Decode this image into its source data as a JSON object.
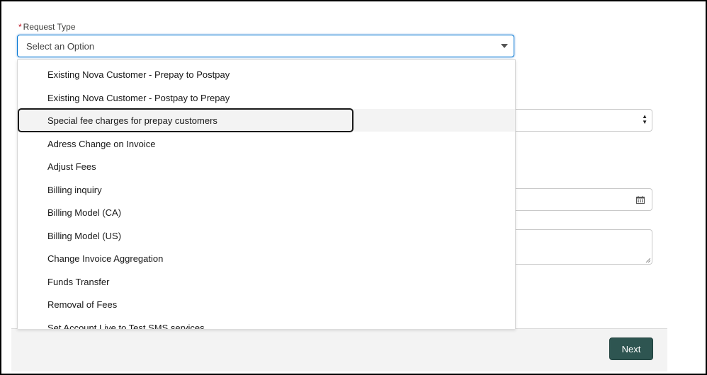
{
  "request_type": {
    "label": "Request Type",
    "required_marker": "*",
    "placeholder": "Select an Option",
    "options": [
      "Existing Nova Customer - Prepay to Postpay",
      "Existing Nova Customer - Postpay to Prepay",
      "Special fee charges for prepay customers",
      "Adress Change on Invoice",
      "Adjust Fees",
      "Billing inquiry",
      "Billing Model (CA)",
      "Billing Model (US)",
      "Change Invoice Aggregation",
      "Funds Transfer",
      "Removal of Fees",
      "Set Account Live to Test SMS services"
    ],
    "highlighted_option": "Special fee charges for prepay customers"
  },
  "footer": {
    "next_label": "Next"
  },
  "icons": {
    "dropdown": "chevron-down-icon",
    "select_arrows": "up-down-arrows-icon",
    "date": "calendar-icon",
    "resize": "resize-handle-icon"
  },
  "colors": {
    "accent": "#0176d3",
    "required": "#ba0517",
    "button": "#2e5551",
    "highlight": "#f3f3f3"
  }
}
